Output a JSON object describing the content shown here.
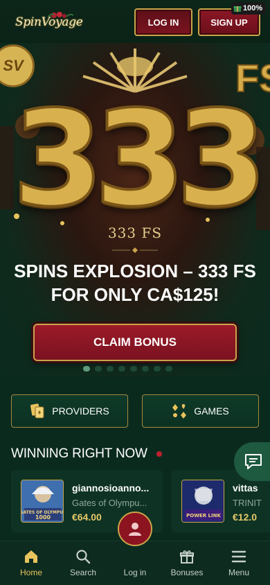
{
  "header": {
    "logo_text": "SpinVoyage",
    "login_label": "LOG IN",
    "signup_label": "SIGN UP",
    "bonus_badge": "100%"
  },
  "hero": {
    "big_number": "333",
    "corner_text": "FS",
    "corner_badge": "SV",
    "fs_small": "333 FS",
    "promo_title": "SPINS EXPLOSION – 333 FS FOR ONLY CA$125!",
    "claim_label": "CLAIM BONUS",
    "slide_count": 8,
    "active_slide": 0
  },
  "categories": [
    {
      "label": "PROVIDERS",
      "icon": "cards-icon"
    },
    {
      "label": "GAMES",
      "icon": "suits-icon"
    }
  ],
  "winning": {
    "title": "WINNING RIGHT NOW",
    "items": [
      {
        "user": "giannosioanno...",
        "game": "Gates of Olympu...",
        "amount": "€64.00",
        "thumb_text": "GATES OF OLYMPUS 1000"
      },
      {
        "user": "vittas",
        "game": "TRINIT",
        "amount": "€12.0",
        "thumb_text": "POWER LINK"
      }
    ]
  },
  "nav": {
    "items": [
      {
        "label": "Home",
        "icon": "home-icon",
        "active": true
      },
      {
        "label": "Search",
        "icon": "search-icon",
        "active": false
      },
      {
        "label": "Log in",
        "icon": "user-icon",
        "active": false
      },
      {
        "label": "Bonuses",
        "icon": "gift-icon",
        "active": false
      },
      {
        "label": "Menu",
        "icon": "menu-icon",
        "active": false
      }
    ]
  },
  "colors": {
    "accent_gold": "#e8c45d",
    "brand_red": "#8c1320",
    "background_green": "#0b2a1e"
  }
}
